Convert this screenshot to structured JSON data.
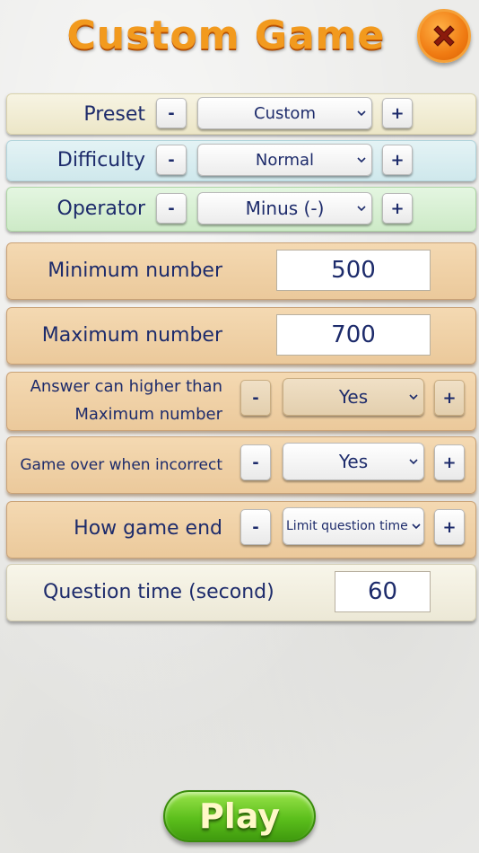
{
  "title": "Custom Game",
  "preset": {
    "label": "Preset",
    "minus": "-",
    "value": "Custom",
    "plus": "+"
  },
  "difficulty": {
    "label": "Difficulty",
    "minus": "-",
    "value": "Normal",
    "plus": "+"
  },
  "operator": {
    "label": "Operator",
    "minus": "-",
    "value": "Minus (-)",
    "plus": "+"
  },
  "min_number": {
    "label": "Minimum number",
    "value": "500"
  },
  "max_number": {
    "label": "Maximum number",
    "value": "700"
  },
  "answer_higher": {
    "label_line1": "Answer can higher than",
    "label_line2": "Maximum number",
    "minus": "-",
    "value": "Yes",
    "plus": "+"
  },
  "game_over": {
    "label": "Game over when incorrect",
    "minus": "-",
    "value": "Yes",
    "plus": "+"
  },
  "how_end": {
    "label": "How game end",
    "minus": "-",
    "value": "Limit question time",
    "plus": "+"
  },
  "question_time": {
    "label": "Question time (second)",
    "value": "60"
  },
  "play_label": "Play",
  "colors": {
    "title": "#f29a1e",
    "close": "#f07b12",
    "play": "#5cbf1c",
    "text": "#1d2b6b"
  }
}
